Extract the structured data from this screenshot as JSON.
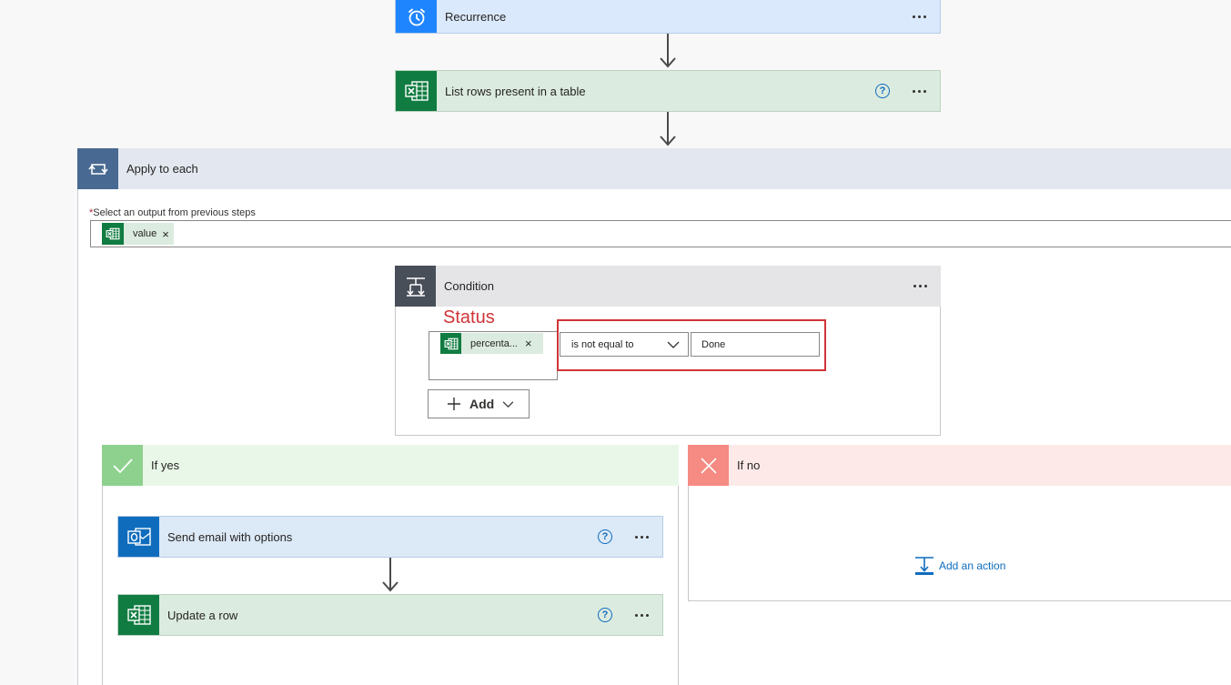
{
  "recurrence": {
    "title": "Recurrence",
    "color": "#1f85ff"
  },
  "list_rows": {
    "title": "List rows present in a table",
    "color": "#107c41"
  },
  "apply_each": {
    "title": "Apply to each",
    "required_mark": "*",
    "field_label": "Select an output from previous steps",
    "token_label": "value",
    "token_remove": "×"
  },
  "condition": {
    "title": "Condition",
    "annotation": "Status",
    "token_label": "percenta...",
    "token_remove": "×",
    "operator": "is not equal to",
    "value": "Done",
    "add_label": "Add"
  },
  "if_yes": {
    "title": "If yes",
    "actions": [
      {
        "title": "Send email with options",
        "color": "#0f6cbd"
      },
      {
        "title": "Update a row",
        "color": "#107c41"
      }
    ]
  },
  "if_no": {
    "title": "If no",
    "add_action_label": "Add an action"
  },
  "help_glyph": "?",
  "colors": {
    "excel": "#107c41",
    "outlook": "#0f6cbd",
    "loop": "#486991",
    "condition": "#484f58",
    "yes": "#8ed18e",
    "no": "#f58b82",
    "highlight": "#d13438"
  }
}
